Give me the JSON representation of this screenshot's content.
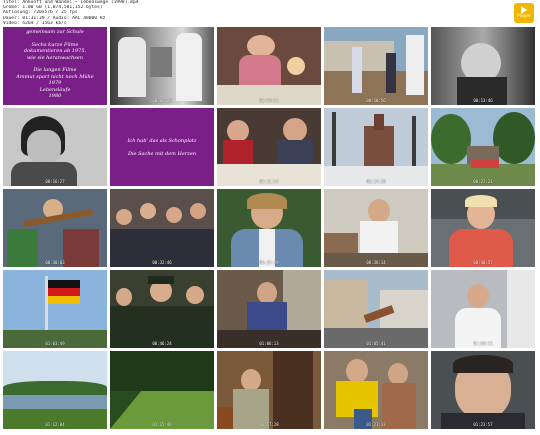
{
  "header": {
    "lines": [
      "Titel: Ankunft und Wandel – Lebenswege (1998).mp4",
      "Größe: 1.00 GB (1,074,581,152 bytes)",
      "Auflösung: 720x576 / 25 fps",
      "Dauer: 01:31:39 / Audio: AAC 48000 Hz",
      "Video: h264 / 1563 kb/s"
    ]
  },
  "logo": {
    "label": "Player"
  },
  "frames": [
    {
      "type": "title",
      "lines": [
        "gemeinsam zur Schule",
        "",
        "Sechs kurze Filme",
        "dokumentieren ab 1975,",
        "wie sie heranwachsen",
        "",
        "Die langen Filme",
        "Ammut spart nicht noch Mühe",
        "1979",
        "Lebensläufe",
        "1980"
      ],
      "timestamp": ""
    },
    {
      "type": "scene",
      "kind": "bw-men",
      "timestamp": "00:05:29"
    },
    {
      "type": "scene",
      "kind": "kitchen",
      "timestamp": "00:08:11"
    },
    {
      "type": "scene",
      "kind": "yard",
      "timestamp": "00:10:56"
    },
    {
      "type": "scene",
      "kind": "bw-kids",
      "timestamp": "00:13:46"
    },
    {
      "type": "scene",
      "kind": "bw-boy",
      "timestamp": "00:16:27"
    },
    {
      "type": "title",
      "lines": [
        "Ich hab' das als Schonplatz",
        "",
        "Die Sache mit dem Herzen"
      ],
      "timestamp": ""
    },
    {
      "type": "scene",
      "kind": "family-table",
      "timestamp": "00:21:54"
    },
    {
      "type": "scene",
      "kind": "church",
      "timestamp": "00:24:38"
    },
    {
      "type": "scene",
      "kind": "memorial",
      "timestamp": "00:27:21"
    },
    {
      "type": "scene",
      "kind": "classroom",
      "timestamp": "00:30:03"
    },
    {
      "type": "scene",
      "kind": "group",
      "timestamp": "00:32:46"
    },
    {
      "type": "scene",
      "kind": "young-man-denim",
      "timestamp": "00:35:29"
    },
    {
      "type": "scene",
      "kind": "woman-room",
      "timestamp": "00:38:14"
    },
    {
      "type": "scene",
      "kind": "blond-man",
      "timestamp": "00:40:57"
    },
    {
      "type": "scene",
      "kind": "flag",
      "timestamp": "01:03:49"
    },
    {
      "type": "scene",
      "kind": "soldiers",
      "timestamp": "00:46:24"
    },
    {
      "type": "scene",
      "kind": "sitting-man",
      "timestamp": "01:06:13"
    },
    {
      "type": "scene",
      "kind": "street",
      "timestamp": "01:05:41"
    },
    {
      "type": "scene",
      "kind": "man-white",
      "timestamp": "01:00:21"
    },
    {
      "type": "scene",
      "kind": "lake",
      "timestamp": "01:12:04"
    },
    {
      "type": "scene",
      "kind": "field",
      "timestamp": "01:15:48"
    },
    {
      "type": "scene",
      "kind": "woman-door",
      "timestamp": "01:17:28"
    },
    {
      "type": "scene",
      "kind": "family-yellow",
      "timestamp": "01:21:13"
    },
    {
      "type": "scene",
      "kind": "man-face",
      "timestamp": "01:23:57"
    }
  ]
}
